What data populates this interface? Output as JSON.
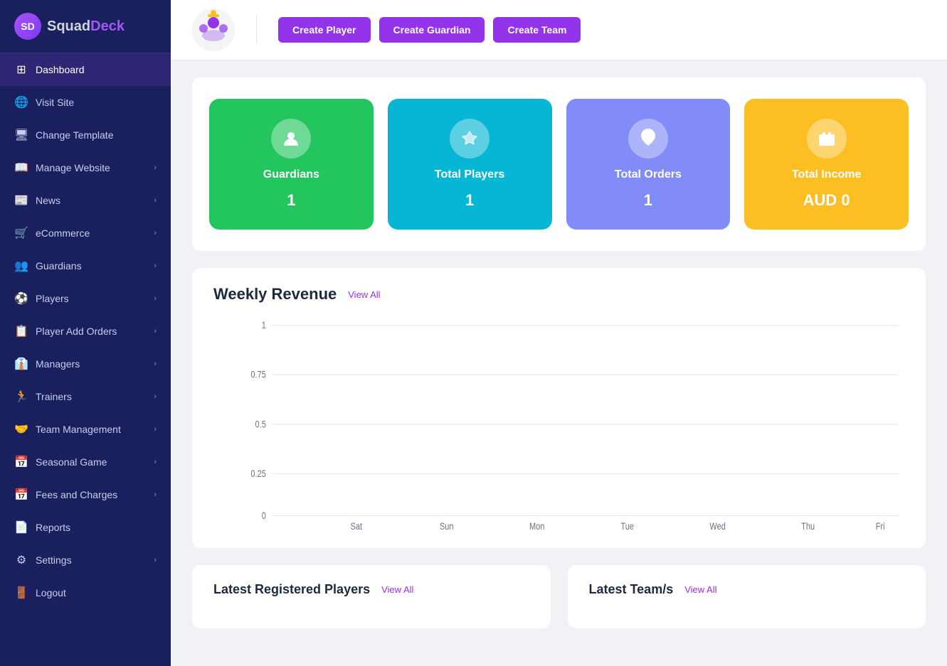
{
  "brand": {
    "squad": "Squad",
    "deck": "Deck",
    "logo_icon": "SD"
  },
  "sidebar": {
    "items": [
      {
        "id": "dashboard",
        "label": "Dashboard",
        "icon": "⊞",
        "has_arrow": false
      },
      {
        "id": "visit-site",
        "label": "Visit Site",
        "icon": "🌐",
        "has_arrow": false
      },
      {
        "id": "change-template",
        "label": "Change Template",
        "icon": "🖥",
        "has_arrow": false
      },
      {
        "id": "manage-website",
        "label": "Manage Website",
        "icon": "📖",
        "has_arrow": true
      },
      {
        "id": "news",
        "label": "News",
        "icon": "📰",
        "has_arrow": true
      },
      {
        "id": "ecommerce",
        "label": "eCommerce",
        "icon": "🛒",
        "has_arrow": true
      },
      {
        "id": "guardians",
        "label": "Guardians",
        "icon": "👥",
        "has_arrow": true
      },
      {
        "id": "players",
        "label": "Players",
        "icon": "⚽",
        "has_arrow": true
      },
      {
        "id": "player-add-orders",
        "label": "Player Add Orders",
        "icon": "📋",
        "has_arrow": true
      },
      {
        "id": "managers",
        "label": "Managers",
        "icon": "👔",
        "has_arrow": true
      },
      {
        "id": "trainers",
        "label": "Trainers",
        "icon": "🏃",
        "has_arrow": true
      },
      {
        "id": "team-management",
        "label": "Team Management",
        "icon": "🤝",
        "has_arrow": true
      },
      {
        "id": "seasonal-game",
        "label": "Seasonal Game",
        "icon": "📅",
        "has_arrow": true
      },
      {
        "id": "fees-and-charges",
        "label": "Fees and Charges",
        "icon": "📅",
        "has_arrow": true
      },
      {
        "id": "reports",
        "label": "Reports",
        "icon": "📄",
        "has_arrow": false
      },
      {
        "id": "settings",
        "label": "Settings",
        "icon": "⚙",
        "has_arrow": true
      },
      {
        "id": "logout",
        "label": "Logout",
        "icon": "🚪",
        "has_arrow": false
      }
    ]
  },
  "topbar": {
    "create_player": "Create Player",
    "create_guardian": "Create Guardian",
    "create_team": "Create Team"
  },
  "stats": [
    {
      "id": "guardians",
      "label": "Guardians",
      "value": "1",
      "color": "green",
      "icon": "👤"
    },
    {
      "id": "total-players",
      "label": "Total Players",
      "value": "1",
      "color": "cyan",
      "icon": "🛡"
    },
    {
      "id": "total-orders",
      "label": "Total Orders",
      "value": "1",
      "color": "purple",
      "icon": "❤"
    },
    {
      "id": "total-income",
      "label": "Total Income",
      "value": "AUD 0",
      "color": "orange",
      "icon": "💳"
    }
  ],
  "revenue": {
    "title": "Weekly Revenue",
    "view_all": "View All",
    "y_labels": [
      "1",
      "0.75",
      "0.5",
      "0.25",
      "0"
    ],
    "x_labels": [
      "Sat",
      "Sun",
      "Mon",
      "Tue",
      "Wed",
      "Thu",
      "Fri"
    ]
  },
  "latest_players": {
    "title": "Latest Registered Players",
    "view_all": "View All"
  },
  "latest_teams": {
    "title": "Latest Team/s",
    "view_all": "View All"
  }
}
